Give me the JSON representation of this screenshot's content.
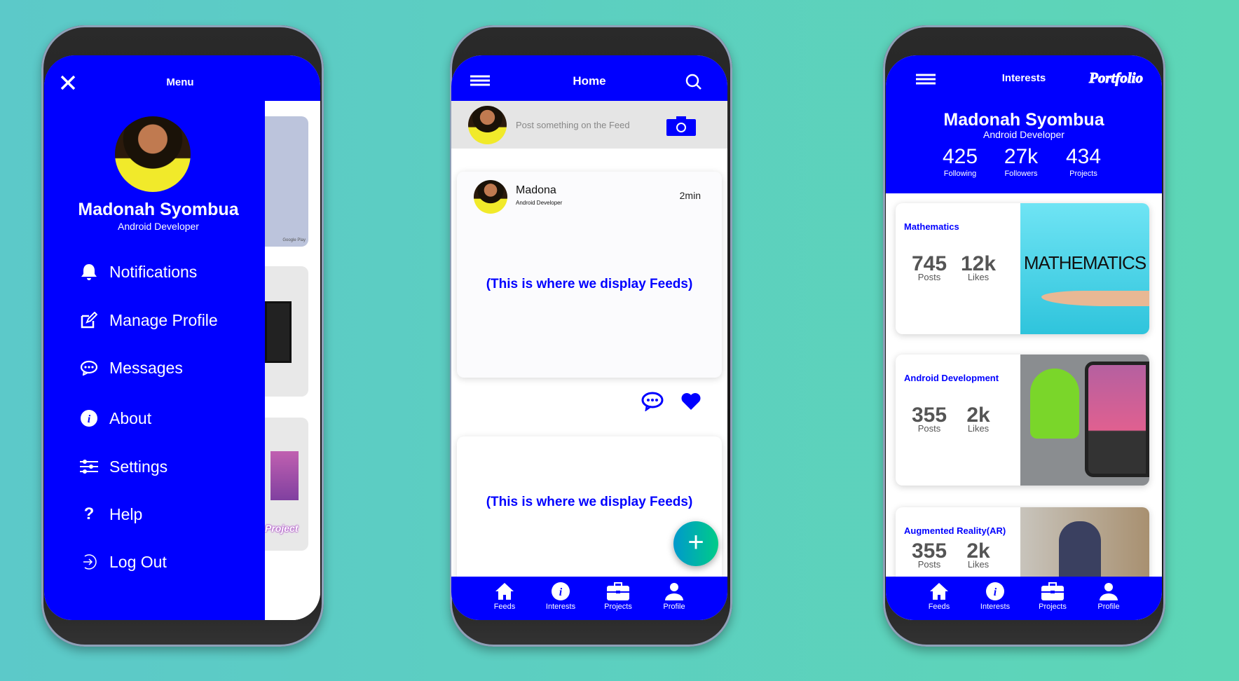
{
  "colors": {
    "primary": "#0000ff",
    "background": "#5cc9c9",
    "fab_gradient": [
      "#0099cc",
      "#00cc88"
    ]
  },
  "drawer": {
    "title": "Menu",
    "close_icon": "close-icon",
    "profile": {
      "name": "Madonah Syombua",
      "role": "Android Developer"
    },
    "items": [
      {
        "label": "Notifications",
        "icon": "bell-icon"
      },
      {
        "label": "Manage Profile",
        "icon": "edit-icon"
      },
      {
        "label": "Messages",
        "icon": "chat-icon"
      },
      {
        "label": "About",
        "icon": "info-icon"
      },
      {
        "label": "Settings",
        "icon": "sliders-icon"
      },
      {
        "label": "Help",
        "icon": "question-icon"
      },
      {
        "label": "Log Out",
        "icon": "logout-icon"
      }
    ],
    "behind": {
      "project_label": "Project",
      "store_badge": "Google Play"
    }
  },
  "home": {
    "title": "Home",
    "post_placeholder": "Post something on the Feed",
    "feed_card": {
      "author": "Madona",
      "role": "Android Developer",
      "time": "2min",
      "content": "(This is where we display Feeds)"
    },
    "feed_card_2": {
      "content": "(This is where we display Feeds)"
    },
    "fab": "+"
  },
  "interests": {
    "title": "Interests",
    "logo": "Portfolio",
    "profile": {
      "name": "Madonah Syombua",
      "role": "Android Developer"
    },
    "stats": [
      {
        "value": "425",
        "label": "Following"
      },
      {
        "value": "27k",
        "label": "Followers"
      },
      {
        "value": "434",
        "label": "Projects"
      }
    ],
    "cards": [
      {
        "title": "Mathematics",
        "posts": "745",
        "posts_label": "Posts",
        "likes": "12k",
        "likes_label": "Likes",
        "image_text": "MATHEMATICS"
      },
      {
        "title": "Android Development",
        "posts": "355",
        "posts_label": "Posts",
        "likes": "2k",
        "likes_label": "Likes"
      },
      {
        "title": "Augmented Reality(AR)",
        "posts": "355",
        "posts_label": "Posts",
        "likes": "2k",
        "likes_label": "Likes"
      }
    ]
  },
  "bottom_nav": [
    {
      "label": "Feeds",
      "icon": "home-icon"
    },
    {
      "label": "Interests",
      "icon": "info-icon"
    },
    {
      "label": "Projects",
      "icon": "briefcase-icon"
    },
    {
      "label": "Profile",
      "icon": "person-icon"
    }
  ]
}
